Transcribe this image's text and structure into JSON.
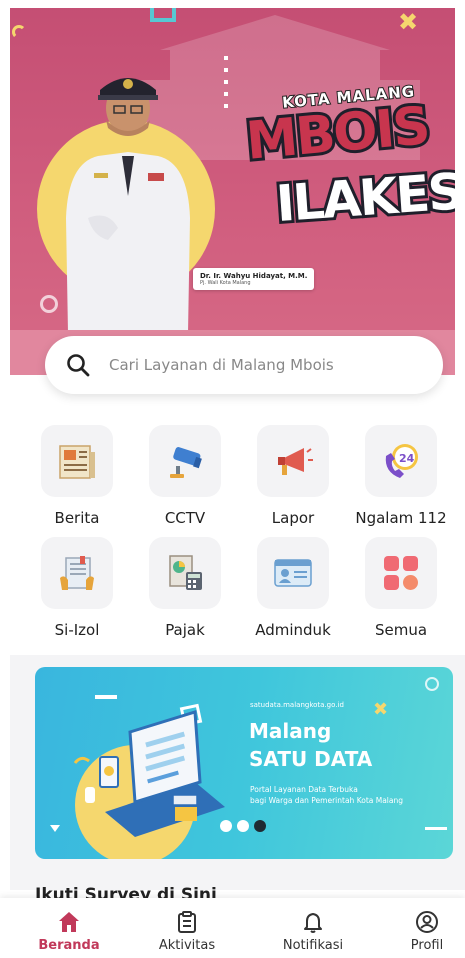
{
  "hero": {
    "official_name": "Dr. Ir. Wahyu Hidayat, M.M.",
    "official_role": "Pj. Wali Kota Malang",
    "brand_top": "KOTA MALANG",
    "brand_main": "MBOIS",
    "brand_bottom": "ILAKES!"
  },
  "search": {
    "placeholder": "Cari Layanan di Malang Mbois"
  },
  "menu": [
    {
      "label": "Berita",
      "icon": "newspaper-icon"
    },
    {
      "label": "CCTV",
      "icon": "cctv-camera-icon"
    },
    {
      "label": "Lapor",
      "icon": "megaphone-icon"
    },
    {
      "label": "Ngalam 112",
      "icon": "emergency-call-24-icon"
    },
    {
      "label": "Si-Izol",
      "icon": "document-permit-icon"
    },
    {
      "label": "Pajak",
      "icon": "tax-calculator-icon"
    },
    {
      "label": "Adminduk",
      "icon": "id-card-icon"
    },
    {
      "label": "Semua",
      "icon": "all-apps-grid-icon"
    }
  ],
  "banner": {
    "url": "satudata.malangkota.go.id",
    "title_line1": "Malang",
    "title_line2": "SATU DATA",
    "subtitle_line1": "Portal Layanan Data Terbuka",
    "subtitle_line2": "bagi Warga dan Pemerintah Kota Malang",
    "slide_count": 3,
    "active_slide": 3
  },
  "survey": {
    "heading": "Ikuti Survey di Sini"
  },
  "nav": {
    "items": [
      {
        "label": "Beranda",
        "icon": "home-icon",
        "active": true
      },
      {
        "label": "Aktivitas",
        "icon": "activity-list-icon",
        "active": false
      },
      {
        "label": "Notifikasi",
        "icon": "bell-icon",
        "active": false
      },
      {
        "label": "Profil",
        "icon": "profile-icon",
        "active": false
      }
    ]
  },
  "colors": {
    "hero_bg": "#c44e73",
    "accent": "#c1395a",
    "banner_bg": "#3fc6dc",
    "yellow": "#f5d76e"
  }
}
